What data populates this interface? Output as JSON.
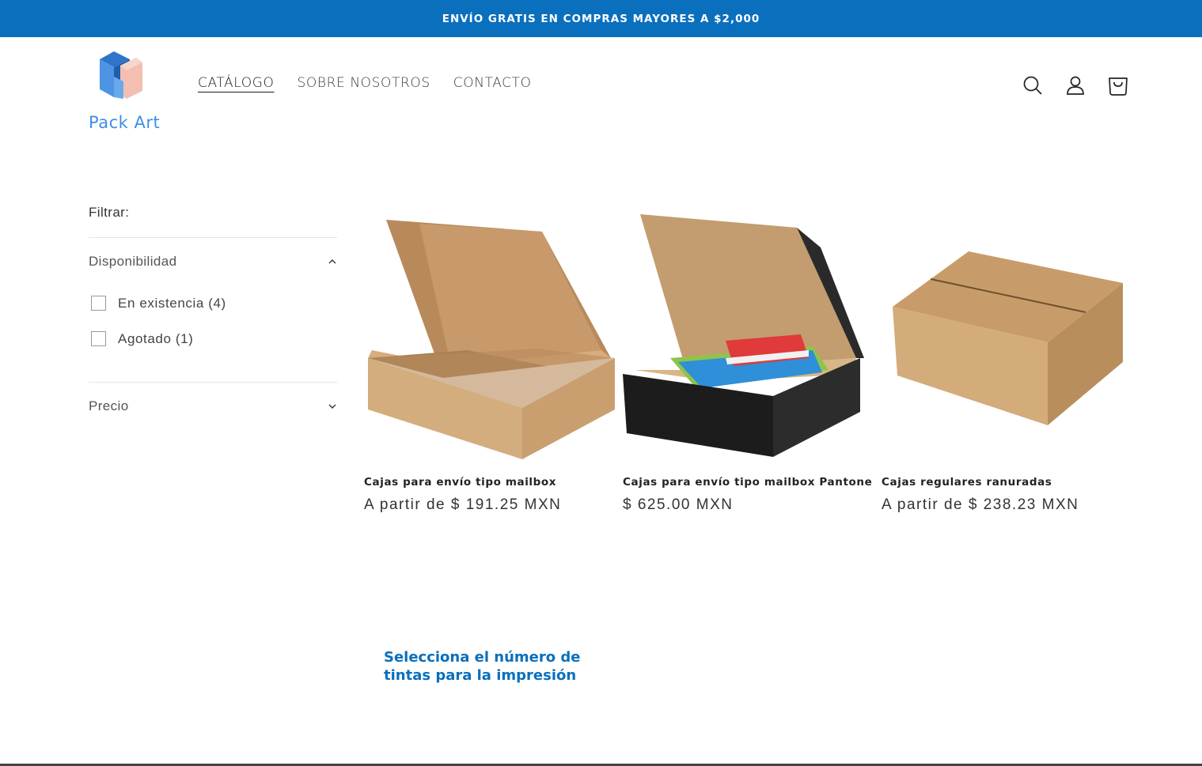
{
  "announcement": "ENVÍO GRATIS EN COMPRAS MAYORES A $2,000",
  "brand": {
    "name": "Pack Art",
    "logo_icon": "cube-logo-icon"
  },
  "nav": {
    "items": [
      {
        "label": "CATÁLOGO",
        "active": true
      },
      {
        "label": "SOBRE NOSOTROS",
        "active": false
      },
      {
        "label": "CONTACTO",
        "active": false
      }
    ]
  },
  "header_icons": [
    "search-icon",
    "account-icon",
    "cart-icon"
  ],
  "filters": {
    "title": "Filtrar:",
    "groups": [
      {
        "label": "Disponibilidad",
        "expanded": true,
        "options": [
          {
            "label": "En existencia (4)",
            "checked": false
          },
          {
            "label": "Agotado (1)",
            "checked": false
          }
        ]
      },
      {
        "label": "Precio",
        "expanded": false
      }
    ]
  },
  "products": [
    {
      "title": "Cajas para envío tipo mailbox",
      "price": "A partir de $ 191.25 MXN"
    },
    {
      "title": "Cajas para envío tipo mailbox Pantone",
      "price": "$ 625.00 MXN"
    },
    {
      "title": "Cajas regulares ranuradas",
      "price": "A partir de $ 238.23 MXN"
    }
  ],
  "promo": {
    "line1": "Selecciona el número de",
    "line2": "tintas para la impresión"
  },
  "colors": {
    "accent": "#0a6fbd",
    "logo_text": "#3d8fe6",
    "cardboard": "#c9a06d"
  }
}
